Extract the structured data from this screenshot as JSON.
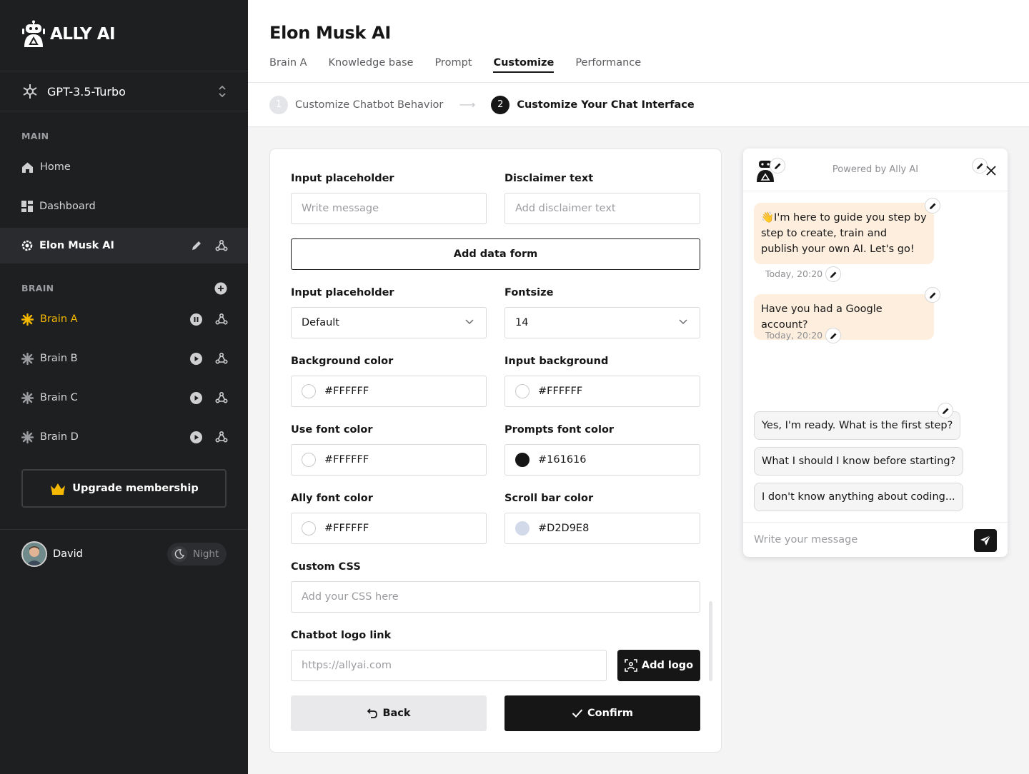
{
  "sidebar": {
    "brand": "ALLY AI",
    "model": "GPT-3.5-Turbo",
    "main_section": "MAIN",
    "main_items": [
      {
        "label": "Home",
        "icon": "home-icon"
      },
      {
        "label": "Dashboard",
        "icon": "dashboard-icon"
      },
      {
        "label": "Elon Musk AI",
        "icon": "gear-icon"
      }
    ],
    "brain_section": "BRAIN",
    "brains": [
      {
        "label": "Brain A",
        "status": "paused"
      },
      {
        "label": "Brain B",
        "status": "play"
      },
      {
        "label": "Brain C",
        "status": "play"
      },
      {
        "label": "Brain D",
        "status": "play"
      }
    ],
    "upgrade": "Upgrade membership",
    "user": {
      "name": "David"
    },
    "theme_toggle": "Night",
    "colors": {
      "bg": "#1E1F21",
      "active_brain": "#F5B800"
    }
  },
  "header": {
    "title": "Elon Musk AI",
    "tabs": [
      "Brain A",
      "Knowledge base",
      "Prompt",
      "Customize",
      "Performance"
    ],
    "active_tab": "Customize"
  },
  "steps": [
    {
      "num": "1",
      "label": "Customize Chatbot Behavior"
    },
    {
      "num": "2",
      "label": "Customize Your Chat Interface"
    }
  ],
  "form": {
    "input_placeholder": {
      "label": "Input placeholder",
      "placeholder": "Write message"
    },
    "disclaimer": {
      "label": "Disclaimer text",
      "placeholder": "Add disclaimer text"
    },
    "add_data_form": "Add data form",
    "input_placeholder_select": {
      "label": "Input placeholder",
      "value": "Default"
    },
    "fontsize": {
      "label": "Fontsize",
      "value": "14"
    },
    "background_color": {
      "label": "Background color",
      "value": "#FFFFFF"
    },
    "input_background": {
      "label": "Input background",
      "value": "#FFFFFF"
    },
    "use_font_color": {
      "label": "Use font color",
      "value": "#FFFFFF"
    },
    "prompts_font_color": {
      "label": "Prompts font color",
      "value": "#161616"
    },
    "ally_font_color": {
      "label": "Ally font color",
      "value": "#FFFFFF"
    },
    "scroll_bar_color": {
      "label": "Scroll bar color",
      "value": "#D2D9E8"
    },
    "custom_css": {
      "label": "Custom CSS",
      "placeholder": "Add your CSS here"
    },
    "logo_link": {
      "label": "Chatbot logo link",
      "placeholder": "https://allyai.com"
    },
    "add_logo": "Add logo",
    "back": "Back",
    "confirm": "Confirm"
  },
  "chat": {
    "powered_by": "Powered by Ally AI",
    "messages": [
      {
        "text": "👋I'm here to guide you step by step to create, train and publish your own AI. Let's go!",
        "time": "Today, 20:20"
      },
      {
        "text": "Have you had a Google account?",
        "time": "Today, 20:20"
      }
    ],
    "suggestions": [
      "Yes, I'm ready. What is the first step?",
      "What I should I know before starting?",
      "I don't know anything about coding..."
    ],
    "input_placeholder": "Write your message",
    "bubble_color": "#FDEEDD"
  }
}
